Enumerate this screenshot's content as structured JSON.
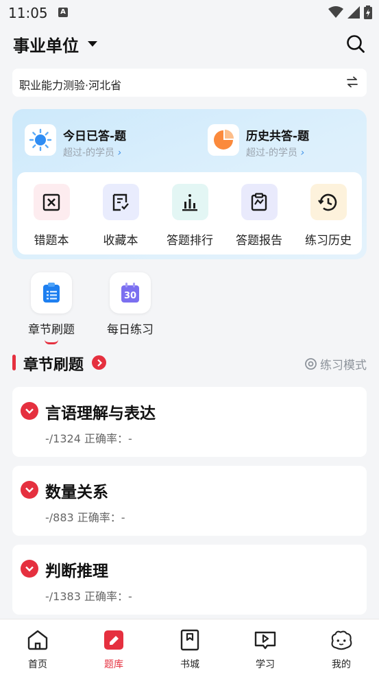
{
  "status": {
    "time": "11:05",
    "a_badge": "A"
  },
  "header": {
    "title": "事业单位"
  },
  "subject": {
    "label": "职业能力测验·河北省"
  },
  "stats": [
    {
      "title": "今日已答-题",
      "sub": "超过-的学员"
    },
    {
      "title": "历史共答-题",
      "sub": "超过-的学员"
    }
  ],
  "tools": [
    {
      "label": "错题本",
      "icon": "wrong-book-icon",
      "bg": "#fdecef",
      "color": "#e5303f"
    },
    {
      "label": "收藏本",
      "icon": "favorites-icon",
      "bg": "#e9ecfd",
      "color": "#3a3f8f"
    },
    {
      "label": "答题排行",
      "icon": "ranking-icon",
      "bg": "#e3f6f4",
      "color": "#1f3a3a"
    },
    {
      "label": "答题报告",
      "icon": "report-icon",
      "bg": "#e9eafc",
      "color": "#2a2d5c"
    },
    {
      "label": "练习历史",
      "icon": "history-icon",
      "bg": "#fdf2dc",
      "color": "#2a2418"
    }
  ],
  "modes": [
    {
      "label": "章节刷题",
      "icon": "chapter-practice-icon",
      "active": true
    },
    {
      "label": "每日练习",
      "icon": "daily-practice-icon",
      "badge": "30",
      "active": false
    }
  ],
  "section": {
    "title": "章节刷题",
    "mode_label": "练习模式"
  },
  "chapters": [
    {
      "title": "言语理解与表达",
      "stats": "-/1324  正确率：-"
    },
    {
      "title": "数量关系",
      "stats": "-/883  正确率：-"
    },
    {
      "title": "判断推理",
      "stats": "-/1383  正确率：-"
    }
  ],
  "nav": [
    {
      "label": "首页",
      "icon": "home-icon"
    },
    {
      "label": "题库",
      "icon": "question-bank-icon",
      "active": true
    },
    {
      "label": "书城",
      "icon": "bookstore-icon"
    },
    {
      "label": "学习",
      "icon": "study-icon"
    },
    {
      "label": "我的",
      "icon": "profile-icon"
    }
  ],
  "colors": {
    "accent": "#e5303f",
    "bg": "#f4f5f7"
  }
}
